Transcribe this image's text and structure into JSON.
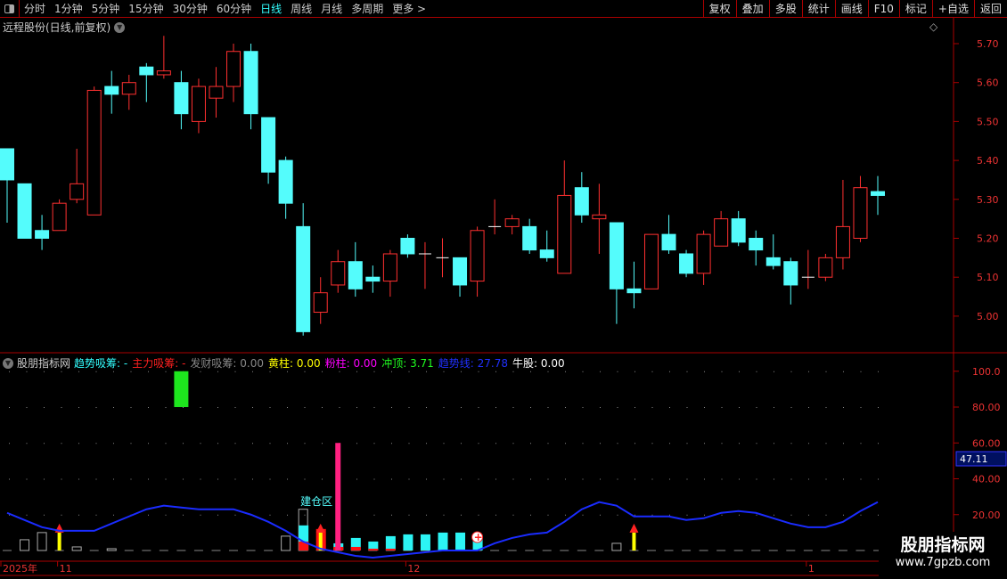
{
  "toolbar": {
    "periods": [
      "分时",
      "1分钟",
      "5分钟",
      "15分钟",
      "30分钟",
      "60分钟",
      "日线",
      "周线",
      "月线",
      "多周期",
      "更多 >"
    ],
    "active": "日线",
    "buttons": [
      "复权",
      "叠加",
      "多股",
      "统计",
      "画线",
      "F10",
      "标记",
      "+自选",
      "返回"
    ]
  },
  "main": {
    "title": "远程股份(日线,前复权)",
    "price_ticks": [
      "5.70",
      "5.60",
      "5.50",
      "5.40",
      "5.30",
      "5.20",
      "5.10",
      "5.00"
    ],
    "candles": [
      [
        5.43,
        5.43,
        5.24,
        5.35
      ],
      [
        5.34,
        5.34,
        5.2,
        5.2
      ],
      [
        5.22,
        5.26,
        5.17,
        5.2
      ],
      [
        5.22,
        5.3,
        5.22,
        5.29
      ],
      [
        5.3,
        5.43,
        5.29,
        5.34
      ],
      [
        5.26,
        5.59,
        5.26,
        5.58
      ],
      [
        5.59,
        5.63,
        5.52,
        5.57
      ],
      [
        5.57,
        5.62,
        5.53,
        5.6
      ],
      [
        5.64,
        5.65,
        5.55,
        5.62
      ],
      [
        5.62,
        5.72,
        5.61,
        5.63
      ],
      [
        5.6,
        5.63,
        5.48,
        5.52
      ],
      [
        5.5,
        5.61,
        5.47,
        5.59
      ],
      [
        5.56,
        5.64,
        5.51,
        5.59
      ],
      [
        5.59,
        5.7,
        5.55,
        5.68
      ],
      [
        5.68,
        5.7,
        5.48,
        5.52
      ],
      [
        5.51,
        5.51,
        5.34,
        5.37
      ],
      [
        5.4,
        5.41,
        5.25,
        5.29
      ],
      [
        5.23,
        5.29,
        4.95,
        4.96
      ],
      [
        5.01,
        5.1,
        4.98,
        5.06
      ],
      [
        5.08,
        5.17,
        5.06,
        5.14
      ],
      [
        5.14,
        5.19,
        5.05,
        5.07
      ],
      [
        5.1,
        5.13,
        5.06,
        5.09
      ],
      [
        5.09,
        5.17,
        5.05,
        5.16
      ],
      [
        5.2,
        5.21,
        5.15,
        5.16
      ],
      [
        5.16,
        5.19,
        5.07,
        5.16
      ],
      [
        5.15,
        5.2,
        5.1,
        5.15
      ],
      [
        5.15,
        5.15,
        5.05,
        5.08
      ],
      [
        5.09,
        5.23,
        5.05,
        5.22
      ],
      [
        5.23,
        5.3,
        5.21,
        5.23
      ],
      [
        5.23,
        5.26,
        5.21,
        5.25
      ],
      [
        5.23,
        5.25,
        5.16,
        5.17
      ],
      [
        5.17,
        5.22,
        5.14,
        5.15
      ],
      [
        5.11,
        5.4,
        5.11,
        5.31
      ],
      [
        5.33,
        5.37,
        5.24,
        5.26
      ],
      [
        5.25,
        5.34,
        5.16,
        5.26
      ],
      [
        5.24,
        5.24,
        4.98,
        5.07
      ],
      [
        5.07,
        5.14,
        5.02,
        5.06
      ],
      [
        5.07,
        5.21,
        5.07,
        5.21
      ],
      [
        5.21,
        5.26,
        5.16,
        5.17
      ],
      [
        5.16,
        5.17,
        5.1,
        5.11
      ],
      [
        5.11,
        5.22,
        5.08,
        5.21
      ],
      [
        5.18,
        5.27,
        5.18,
        5.25
      ],
      [
        5.25,
        5.27,
        5.18,
        5.19
      ],
      [
        5.2,
        5.22,
        5.13,
        5.17
      ],
      [
        5.15,
        5.21,
        5.12,
        5.13
      ],
      [
        5.14,
        5.15,
        5.03,
        5.08
      ],
      [
        5.1,
        5.17,
        5.07,
        5.1
      ],
      [
        5.1,
        5.16,
        5.09,
        5.15
      ],
      [
        5.15,
        5.35,
        5.12,
        5.23
      ],
      [
        5.2,
        5.36,
        5.19,
        5.33
      ],
      [
        5.32,
        5.36,
        5.26,
        5.31
      ]
    ]
  },
  "indicator": {
    "name": "股朋指标网",
    "items": [
      {
        "label": "趋势吸筹:",
        "value": "-",
        "color": "#33ffff"
      },
      {
        "label": "主力吸筹:",
        "value": "-",
        "color": "#ff2020"
      },
      {
        "label": "发财吸筹:",
        "value": "0.00",
        "color": "#888888"
      },
      {
        "label": "黄柱:",
        "value": "0.00",
        "color": "#ffff00"
      },
      {
        "label": "粉柱:",
        "value": "0.00",
        "color": "#ff00ff"
      },
      {
        "label": "冲顶:",
        "value": "3.71",
        "color": "#20ff20"
      },
      {
        "label": "趋势线:",
        "value": "27.78",
        "color": "#2030ff"
      },
      {
        "label": "牛股:",
        "value": "0.00",
        "color": "#ffffff"
      }
    ],
    "ticks": [
      "100.0",
      "80.00",
      "60.00",
      "40.00",
      "20.00"
    ],
    "current_value": "47.11",
    "zone_label": "建仓区",
    "trend_line": [
      21,
      17,
      13,
      11,
      11,
      11,
      15,
      19,
      23,
      25,
      24,
      23,
      23,
      23,
      20,
      16,
      11,
      5,
      1,
      -1,
      -3,
      -4,
      -3,
      -2,
      -1,
      0,
      0,
      0,
      4,
      7,
      9,
      10,
      16,
      23,
      27,
      25,
      19,
      19,
      19,
      17,
      18,
      21,
      22,
      21,
      18,
      15,
      13,
      13,
      16,
      22,
      27
    ],
    "hollow_bars": {
      "1": 6,
      "2": 10,
      "4": 2,
      "6": 1,
      "16": 8,
      "17": 23,
      "35": 4
    },
    "cyan_bars": {
      "17": 14,
      "19": 4,
      "20": 7,
      "21": 5,
      "22": 8,
      "23": 9,
      "24": 9,
      "25": 10,
      "26": 10,
      "27": 8
    },
    "red_bars": {
      "17": 5,
      "18": 12,
      "19": 2,
      "20": 2,
      "21": 1,
      "22": 1
    },
    "pink_bar": {
      "index": 19,
      "value": 60
    },
    "green_block": {
      "index": 10,
      "from": 80,
      "to": 100
    },
    "arrows": [
      3,
      18,
      36
    ]
  },
  "time_axis": {
    "labels": [
      {
        "text": "2025年",
        "i": 0
      },
      {
        "text": "11",
        "i": 3
      },
      {
        "text": "12",
        "i": 23
      },
      {
        "text": "1",
        "i": 46
      }
    ]
  },
  "watermark": {
    "line1": "股朋指标网",
    "line2": "www.7gpzb.com"
  }
}
